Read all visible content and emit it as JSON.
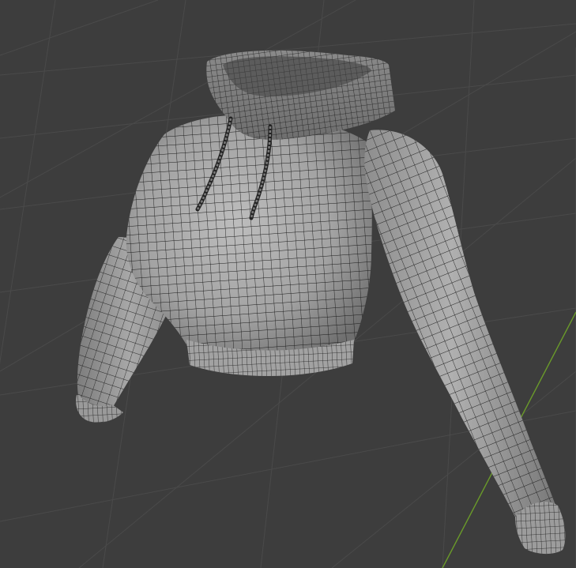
{
  "viewport": {
    "background_color": "#3d3d3d",
    "grid_color": "#4a4a4a",
    "axis_y_color": "#6a9a2a",
    "mesh_fill_color": "#9c9c9c",
    "wire_color": "#1a1a1a",
    "object": "cropped-hoodie-mesh",
    "shading": "solid-with-wireframe"
  }
}
